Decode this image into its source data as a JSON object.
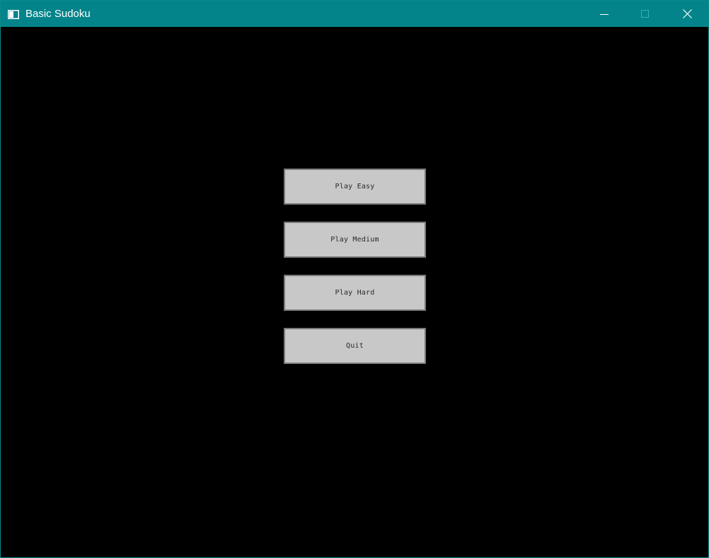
{
  "window": {
    "title": "Basic Sudoku",
    "icon": "app-window-icon",
    "controls": {
      "minimize_icon": "minimize-icon",
      "maximize_icon": "maximize-icon",
      "close_icon": "close-icon"
    }
  },
  "menu": {
    "buttons": [
      {
        "label": "Play Easy"
      },
      {
        "label": "Play Medium"
      },
      {
        "label": "Play Hard"
      },
      {
        "label": "Quit"
      }
    ]
  },
  "colors": {
    "titlebar": "#03848a",
    "background": "#000000",
    "button_fill": "#c8c8c8",
    "button_border": "#7a7a7a",
    "button_text": "#2a2a2a"
  }
}
